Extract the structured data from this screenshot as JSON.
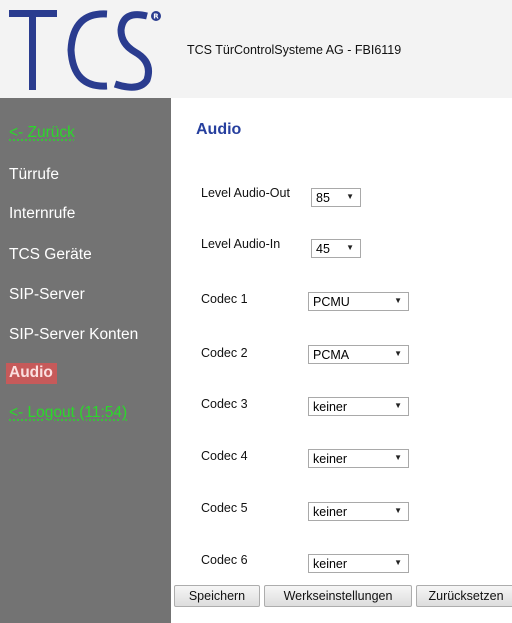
{
  "header": {
    "company": "TCS TürControlSysteme AG - FBI6119"
  },
  "sidebar": {
    "items": [
      {
        "label": "<- Zurück"
      },
      {
        "label": "Türrufe"
      },
      {
        "label": "Internrufe"
      },
      {
        "label": "TCS Geräte"
      },
      {
        "label": "SIP-Server"
      },
      {
        "label": "SIP-Server Konten"
      },
      {
        "label": "Audio"
      },
      {
        "label": "<- Logout (11:54)"
      }
    ]
  },
  "main": {
    "title": "Audio",
    "fields": [
      {
        "label": "Level Audio-Out",
        "value": "85"
      },
      {
        "label": "Level Audio-In",
        "value": "45"
      },
      {
        "label": "Codec 1",
        "value": "PCMU"
      },
      {
        "label": "Codec 2",
        "value": "PCMA"
      },
      {
        "label": "Codec 3",
        "value": "keiner"
      },
      {
        "label": "Codec 4",
        "value": "keiner"
      },
      {
        "label": "Codec 5",
        "value": "keiner"
      },
      {
        "label": "Codec 6",
        "value": "keiner"
      }
    ]
  },
  "buttons": {
    "save": "Speichern",
    "factory": "Werkseinstellungen",
    "reset": "Zurücksetzen"
  },
  "colors": {
    "title": "#263f9e",
    "sidebar_bg": "#737373",
    "nav_link": "#2bd82b",
    "active_bg": "#c65a5a"
  }
}
